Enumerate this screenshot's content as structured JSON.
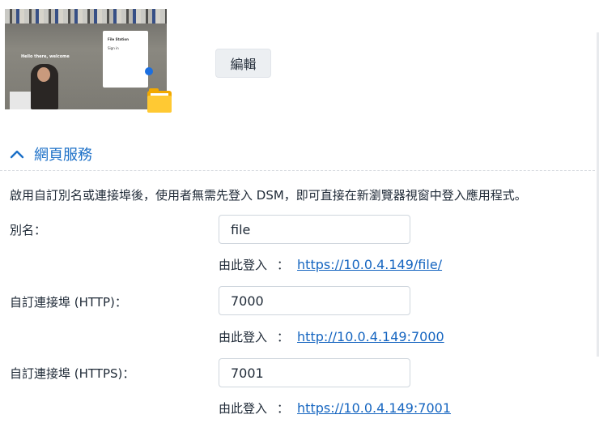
{
  "thumbnail": {
    "hello_text": "Hello there, welcome",
    "card_title": "File Station",
    "card_sub": "Sign in"
  },
  "edit_button": {
    "label": "編輯"
  },
  "section": {
    "title": "網頁服務",
    "description": "啟用自訂別名或連接埠後，使用者無需先登入 DSM，即可直接在新瀏覽器視窗中登入應用程式。"
  },
  "fields": [
    {
      "label": "別名：",
      "value": "file",
      "login_label": "由此登入",
      "login_colon": "：",
      "login_url": "https://10.0.4.149/file/"
    },
    {
      "label": "自訂連接埠 (HTTP)：",
      "value": "7000",
      "login_label": "由此登入",
      "login_colon": "：",
      "login_url": "http://10.0.4.149:7000"
    },
    {
      "label": "自訂連接埠 (HTTPS)：",
      "value": "7001",
      "login_label": "由此登入",
      "login_colon": "：",
      "login_url": "https://10.0.4.149:7001"
    }
  ],
  "colors": {
    "accent": "#1b6fc7",
    "link": "#1565c0",
    "folder": "#ffc933"
  },
  "icons": {
    "collapse": "chevron-up-icon",
    "app": "folder-icon"
  }
}
